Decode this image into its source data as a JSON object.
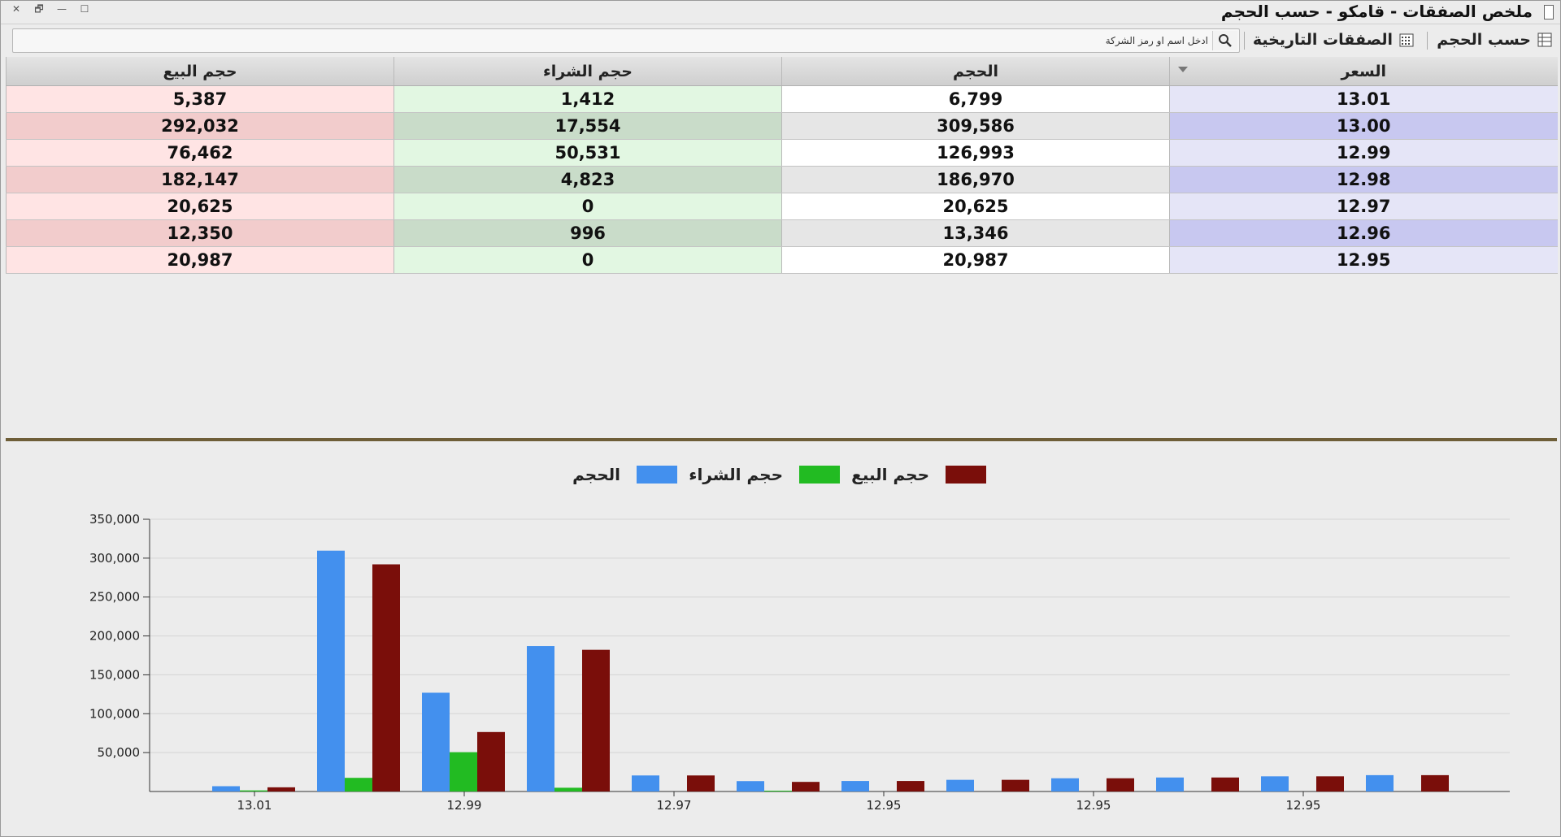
{
  "window": {
    "title": "ملخص الصفقات - قامكو - حسب الحجم",
    "buttons": {
      "close": "✕",
      "restore": "🗗",
      "minimize": "—",
      "maximize": "☐"
    }
  },
  "toolbar": {
    "by_volume_label": "حسب الحجم",
    "historical_label": "الصفقات التاريخية",
    "search_placeholder": "ادخل اسم او رمز الشركة"
  },
  "table": {
    "headers": {
      "price": "السعر",
      "volume": "الحجم",
      "buy_volume": "حجم الشراء",
      "sell_volume": "حجم البيع"
    },
    "rows": [
      {
        "price": "13.01",
        "volume": "6,799",
        "buy": "1,412",
        "sell": "5,387"
      },
      {
        "price": "13.00",
        "volume": "309,586",
        "buy": "17,554",
        "sell": "292,032"
      },
      {
        "price": "12.99",
        "volume": "126,993",
        "buy": "50,531",
        "sell": "76,462"
      },
      {
        "price": "12.98",
        "volume": "186,970",
        "buy": "4,823",
        "sell": "182,147"
      },
      {
        "price": "12.97",
        "volume": "20,625",
        "buy": "0",
        "sell": "20,625"
      },
      {
        "price": "12.96",
        "volume": "13,346",
        "buy": "996",
        "sell": "12,350"
      },
      {
        "price": "12.95",
        "volume": "20,987",
        "buy": "0",
        "sell": "20,987"
      }
    ]
  },
  "chart_data": {
    "type": "bar",
    "categories": [
      "13.01",
      "13.00",
      "12.99",
      "12.98",
      "12.97",
      "12.96",
      "12.95",
      "12.95",
      "12.95",
      "12.95",
      "12.95",
      "12.95",
      "12.95"
    ],
    "x_tick_labels": [
      "13.01",
      "12.99",
      "12.97",
      "12.95",
      "12.95",
      "12.95"
    ],
    "series": [
      {
        "name": "الحجم",
        "color": "#4390ee",
        "values": [
          6799,
          309586,
          126993,
          186970,
          20625,
          13346,
          13500,
          15000,
          17000,
          18000,
          19500,
          21000
        ]
      },
      {
        "name": "حجم الشراء",
        "color": "#22bb22",
        "values": [
          1412,
          17554,
          50531,
          4823,
          0,
          996,
          0,
          0,
          0,
          0,
          0,
          0
        ]
      },
      {
        "name": "حجم البيع",
        "color": "#7a0e0a",
        "values": [
          5387,
          292032,
          76462,
          182147,
          20625,
          12350,
          13500,
          15000,
          17000,
          18000,
          19500,
          21000
        ]
      }
    ],
    "ylim": [
      0,
      350000
    ],
    "y_ticks": [
      "350,000",
      "300,000",
      "250,000",
      "200,000",
      "150,000",
      "100,000",
      "50,000"
    ],
    "grid": true,
    "legend_position": "top-center"
  },
  "colors": {
    "splitter": "#6e5e38",
    "accent_price": "#c8c8f0",
    "accent_buy": "#e2f7e2",
    "accent_sell": "#ffe4e4"
  }
}
